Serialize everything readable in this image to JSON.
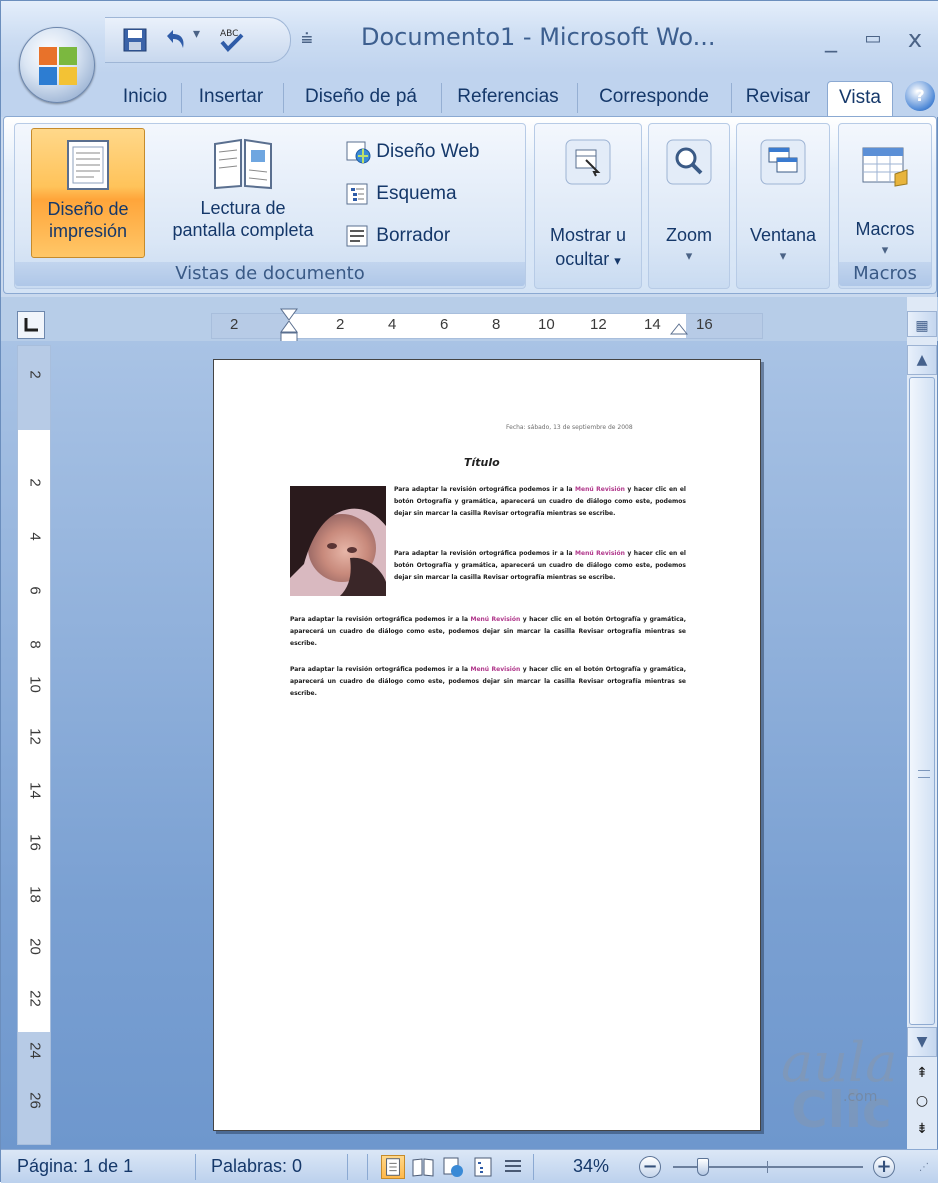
{
  "titlebar": {
    "title": "Documento1 - Microsoft Wo...",
    "minimize": "_",
    "maximize": "▭",
    "close": "x"
  },
  "tabs": [
    {
      "label": "Inicio"
    },
    {
      "label": "Insertar"
    },
    {
      "label": "Diseño de pá"
    },
    {
      "label": "Referencias"
    },
    {
      "label": "Corresponde"
    },
    {
      "label": "Revisar"
    },
    {
      "label": "Vista"
    }
  ],
  "active_tab": "Vista",
  "ribbon": {
    "vistas_group": {
      "label": "Vistas de documento",
      "diseno_impresion": {
        "line1": "Diseño de",
        "line2": "impresión"
      },
      "lectura": {
        "line1": "Lectura de",
        "line2": "pantalla completa"
      },
      "diseno_web": "Diseño Web",
      "esquema": "Esquema",
      "borrador": "Borrador"
    },
    "mostrar": {
      "line1": "Mostrar u",
      "line2": "ocultar",
      "arrow": "▾"
    },
    "zoom": {
      "label": "Zoom",
      "arrow": "▾"
    },
    "ventana": {
      "label": "Ventana",
      "arrow": "▾"
    },
    "macros_group": {
      "label": "Macros",
      "button": "Macros",
      "arrow": "▾"
    }
  },
  "ruler": {
    "h_ticks": [
      "2",
      "2",
      "4",
      "6",
      "8",
      "10",
      "12",
      "14",
      "16"
    ],
    "v_ticks": [
      "2",
      "2",
      "4",
      "6",
      "8",
      "10",
      "12",
      "14",
      "16",
      "18",
      "20",
      "22",
      "24",
      "26"
    ]
  },
  "document": {
    "date": "Fecha: sábado, 13 de septiembre de 2008",
    "title": "Título",
    "p1_a": "Para adaptar la revisión ortográfica podemos ir a la ",
    "p1_pink": "Menú Revisión",
    "p1_b": " y hacer clic en el botón Ortografía y gramática, aparecerá un cuadro de diálogo como este, podemos dejar sin marcar la casilla Revisar ortografía mientras se escribe.",
    "p2_a": "Para adaptar la revisión ortográfica podemos ir a la ",
    "p2_pink": "Menú Revisión",
    "p2_b": " y hacer clic en el botón Ortografía y gramática, aparecerá un cuadro de diálogo como este, podemos dejar sin marcar la casilla Revisar ortografía mientras se escribe.",
    "p3_a": "Para adaptar la revisión ortográfica podemos ir a la ",
    "p3_pink": "Menú Revisión",
    "p3_b": " y hacer clic en el botón Ortografía y gramática, aparecerá un cuadro de diálogo como este, podemos dejar sin marcar la casilla Revisar ortografía mientras se escribe.",
    "p4_a": "Para adaptar la revisión ortográfica podemos ir a la ",
    "p4_pink": "Menú Revisión",
    "p4_b": " y hacer clic en el botón Ortografía y gramática, aparecerá un cuadro de diálogo como este, podemos dejar sin marcar la casilla Revisar ortografía mientras se escribe."
  },
  "statusbar": {
    "page": "Página: 1 de 1",
    "words": "Palabras: 0",
    "zoom": "34%",
    "zoom_out": "−",
    "zoom_in": "+",
    "zoom_level": 0.34
  },
  "watermark": {
    "line1": "aula",
    "line2": "Clic",
    "line3": ".com"
  },
  "colors": {
    "ribbon_active": "#ffc35a",
    "accent": "#15386a",
    "link_pink": "#b0368a"
  },
  "icons": [
    "office-logo-icon",
    "save-icon",
    "undo-icon",
    "spelling-icon",
    "help-icon",
    "print-layout-icon",
    "full-screen-reading-icon",
    "web-layout-icon",
    "outline-icon",
    "draft-icon",
    "show-hide-icon",
    "zoom-icon",
    "window-icon",
    "macros-icon"
  ]
}
